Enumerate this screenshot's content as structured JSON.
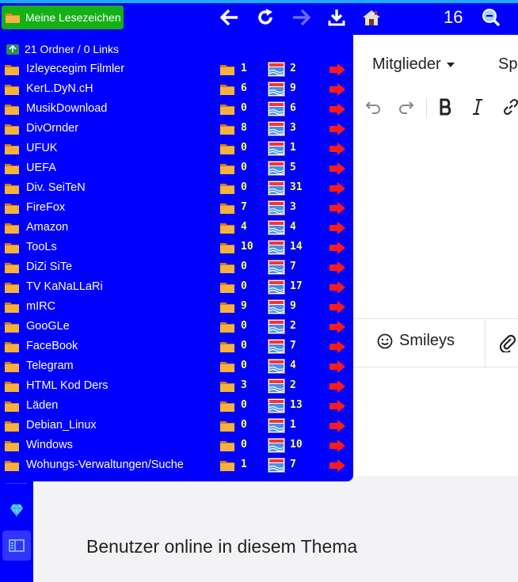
{
  "toolbar": {
    "bookmarks_button": "Meine Lesezeichen",
    "icons": [
      "back-arrow-icon",
      "reload-icon",
      "forward-arrow-icon",
      "download-icon",
      "home-icon",
      "zoom-icon"
    ],
    "counter": "16"
  },
  "bookmarks_panel": {
    "summary": "21 Ordner / 0 Links",
    "folders": [
      {
        "name": "Izleyecegim Filmler",
        "subfolders": "1",
        "links": "2"
      },
      {
        "name": "KerL.DyN.cH",
        "subfolders": "6",
        "links": "9"
      },
      {
        "name": "MusikDownload",
        "subfolders": "0",
        "links": "6"
      },
      {
        "name": "DivOrnder",
        "subfolders": "8",
        "links": "3"
      },
      {
        "name": "UFUK",
        "subfolders": "0",
        "links": "1"
      },
      {
        "name": "UEFA",
        "subfolders": "0",
        "links": "5"
      },
      {
        "name": "Div. SeiTeN",
        "subfolders": "0",
        "links": "31"
      },
      {
        "name": "FireFox",
        "subfolders": "7",
        "links": "3"
      },
      {
        "name": "Amazon",
        "subfolders": "4",
        "links": "4"
      },
      {
        "name": "TooLs",
        "subfolders": "10",
        "links": "14"
      },
      {
        "name": "DiZi SiTe",
        "subfolders": "0",
        "links": "7"
      },
      {
        "name": "TV KaNaLLaRi",
        "subfolders": "0",
        "links": "17"
      },
      {
        "name": "mIRC",
        "subfolders": "9",
        "links": "9"
      },
      {
        "name": "GooGLe",
        "subfolders": "0",
        "links": "2"
      },
      {
        "name": "FaceBook",
        "subfolders": "0",
        "links": "7"
      },
      {
        "name": "Telegram",
        "subfolders": "0",
        "links": "4"
      },
      {
        "name": "HTML Kod Ders",
        "subfolders": "3",
        "links": "2"
      },
      {
        "name": "Läden",
        "subfolders": "0",
        "links": "13"
      },
      {
        "name": "Debian_Linux",
        "subfolders": "0",
        "links": "1"
      },
      {
        "name": "Windows",
        "subfolders": "0",
        "links": "10"
      },
      {
        "name": "Wohungs-Verwaltungen/Suche",
        "subfolders": "1",
        "links": "7"
      }
    ]
  },
  "page": {
    "nav_members": "Mitglieder",
    "nav_partial": "Sp",
    "smileys_label": "Smileys",
    "online_heading": "Benutzer online in diesem Thema"
  },
  "colors": {
    "panel_bg": "#0000ff",
    "bookmark_button": "#15b015",
    "count_text": "#ffff5a",
    "arrow": "#ff1a1a",
    "folder": "#f5a020"
  }
}
